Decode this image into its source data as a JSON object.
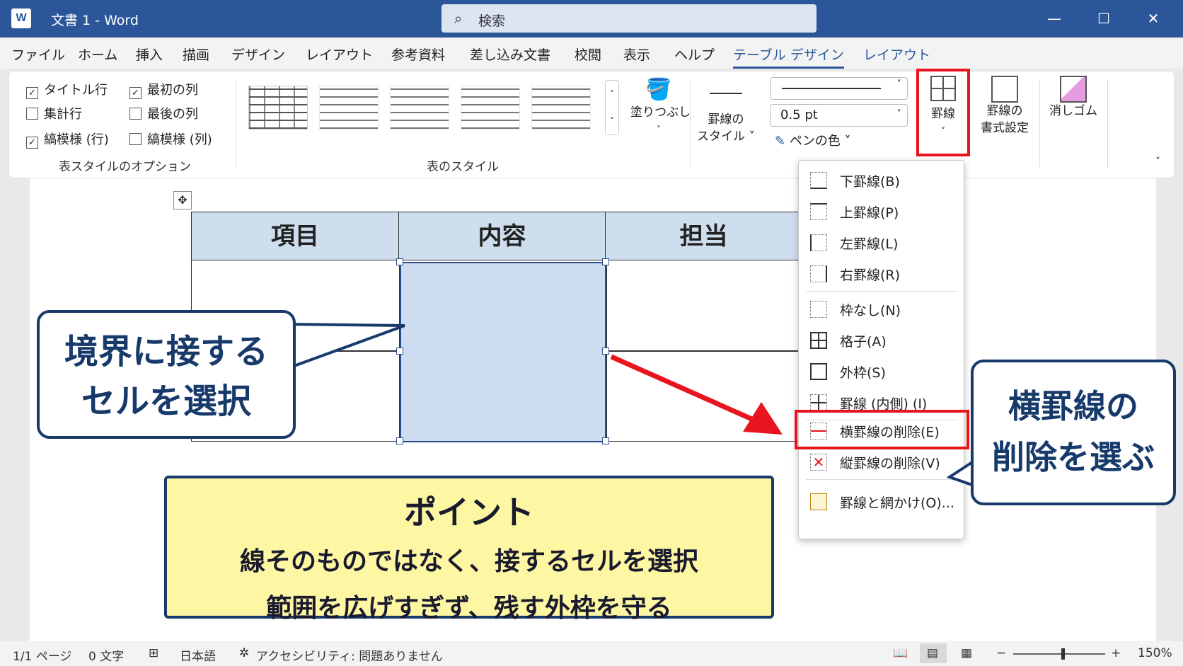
{
  "window": {
    "title": "文書 1  -  Word",
    "app_logo": "W",
    "search": "検索",
    "controls": [
      "—",
      "☐",
      "✕"
    ]
  },
  "menu": [
    "ファイル",
    "ホーム",
    "挿入",
    "描画",
    "デザイン",
    "レイアウト",
    "参考資料",
    "差し込み文書",
    "校閲",
    "表示",
    "ヘルプ",
    "テーブル デザイン",
    "レイアウト"
  ],
  "ribbon": {
    "options": {
      "title_row": "タイトル行",
      "total_row": "集計行",
      "banded_rows": "縞模様 (行)",
      "first_col": "最初の列",
      "last_col": "最後の列",
      "banded_cols": "縞模様 (列)",
      "group": "表スタイルのオプション"
    },
    "styles_group": "表のスタイル",
    "shading": "塗りつぶし",
    "border_styles_1": "罫線の",
    "border_styles_2": "スタイル",
    "pen_weight": "0.5 pt",
    "pen_color": "ペンの色",
    "borders": "罫線",
    "border_painter_1": "罫線の",
    "border_painter_2": "書式設定",
    "eraser": "消しゴム"
  },
  "table": {
    "headers": [
      "項目",
      "内容",
      "担当"
    ]
  },
  "dropdown": [
    "下罫線(B)",
    "上罫線(P)",
    "左罫線(L)",
    "右罫線(R)",
    "枠なし(N)",
    "格子(A)",
    "外枠(S)",
    "罫線 (内側) (I)",
    "横罫線の削除(E)",
    "縦罫線の削除(V)",
    "罫線と網かけ(O)..."
  ],
  "callouts": {
    "left_1": "境界に接する",
    "left_2": "セルを選択",
    "right_1": "横罫線の",
    "right_2": "削除を選ぶ",
    "point_title": "ポイント",
    "point_1": "線そのものではなく、接するセルを選択",
    "point_2": "範囲を広げすぎず、残す外枠を守る"
  },
  "status": {
    "page": "1/1 ページ",
    "words": "0 文字",
    "lang": "日本語",
    "access": "アクセシビリティ: 問題ありません",
    "zoom": "150%"
  },
  "colors": {
    "word_blue": "#2b579a",
    "highlight_red": "#e8141e",
    "callout_navy": "#173a6b",
    "note_yellow": "#fdf6a2"
  }
}
